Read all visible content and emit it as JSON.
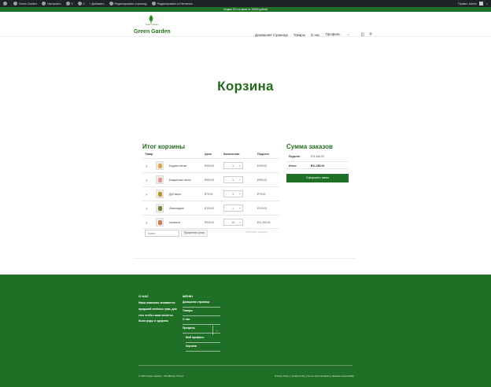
{
  "admin_bar": {
    "site": "Green Garden",
    "customize": "Настроить",
    "comments": "0",
    "new": "Добавить",
    "edit_page": "Редактировать страницу",
    "elementor": "Редактировать в Elementor",
    "greeting": "Привет, Admin"
  },
  "promo": {
    "text": "Скидка 3% на заказ от 10000 рублей"
  },
  "header": {
    "logo_sub": "Green Garden",
    "logo_text": "Green Garden",
    "nav": [
      "Домашняя страница",
      "Товары",
      "О нас",
      "Профиль"
    ],
    "nav_chevron": "⌄"
  },
  "page": {
    "title": "Корзина"
  },
  "cart": {
    "title": "Итог корзины",
    "columns": {
      "product": "Товар",
      "price": "Цена",
      "quantity": "Количество",
      "subtotal": "Подытог"
    },
    "rows": [
      {
        "name": "Бодрая клетка",
        "price": "₽499.00",
        "qty": "1",
        "subtotal": "₽499.00",
        "thumb_color": "#d4a84d"
      },
      {
        "name": "Бюджетные печка",
        "price": "₽590.00",
        "qty": "1",
        "subtotal": "₽590.00",
        "thumb_color": "#e19a8d"
      },
      {
        "name": "Дуб мира",
        "price": "₽79.00",
        "qty": "1",
        "subtotal": "₽79.00",
        "thumb_color": "#b8922f"
      },
      {
        "name": "Лимонадник",
        "price": "₽129.00",
        "qty": "1",
        "subtotal": "₽129.00",
        "thumb_color": "#6c8a3a"
      },
      {
        "name": "Калангоя",
        "price": "₽949.00",
        "qty": "10",
        "subtotal": "₽11,206.00",
        "thumb_color": "#c87e57"
      }
    ],
    "remove_symbol": "×",
    "qty_minus": "-",
    "qty_plus": "+",
    "coupon_placeholder": "Купон",
    "apply_coupon": "Применить купон",
    "update_cart": "Обновить корзину"
  },
  "totals": {
    "title": "Сумма заказов",
    "subtotal_label": "Подытог",
    "subtotal_value": "₽11,646.00",
    "total_label": "Итого",
    "total_value": "₽11,266.00",
    "checkout": "Оформить заказ"
  },
  "footer": {
    "about_title": "О НАС",
    "about_text": "Наша компания занимается продажей зелёных трав, для того чтобы наши клиенты были рады и здоровы",
    "menu_title": "МЕНЮ",
    "menu": [
      "Домашняя страница",
      "Товары",
      "О нас",
      "Профиль"
    ],
    "submenu": [
      "Мой профиль",
      "Корзина"
    ],
    "toggle": "⌄",
    "copyright": "© 2024 Green Garden · WordPress Theme",
    "links": "Privacy Policy | Cookie Policy | Terms and Conditions | Website Accessibility"
  },
  "colors": {
    "brand_green": "#1f6f26",
    "title_green": "#256b1f",
    "admin_bar": "#1d2327"
  }
}
